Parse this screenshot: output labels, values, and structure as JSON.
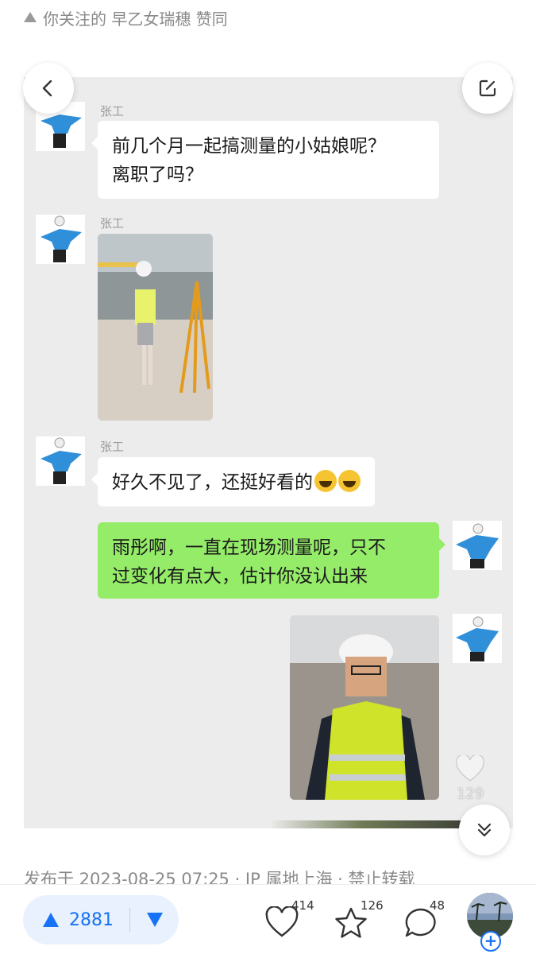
{
  "follow_bar": {
    "text": "你关注的 早乙女瑞穗 赞同"
  },
  "chat": {
    "messages": [
      {
        "sender": "张工",
        "text_line1": "前几个月一起搞测量的小姑娘呢？",
        "text_line2": "离职了吗？"
      },
      {
        "sender": "张工"
      },
      {
        "sender": "张工",
        "text": "好久不见了，还挺好看的"
      },
      {
        "text_line1": "雨彤啊，一直在现场测量呢，只不",
        "text_line2": "过变化有点大，估计你没认出来"
      }
    ]
  },
  "image_like": {
    "count": "129"
  },
  "publish_meta": "发布于 2023-08-25 07:25 · IP 属地上海 · 禁止转载",
  "bottom_bar": {
    "upvote_count": "2881",
    "likes": "414",
    "favorites": "126",
    "comments": "48"
  },
  "colors": {
    "accent": "#1772f6",
    "green_bubble": "#95ec69",
    "chat_bg": "#ececec"
  },
  "icons": [
    "triangle-up-icon",
    "back-arrow-icon",
    "edit-icon",
    "heart-icon",
    "double-chevron-down-icon",
    "upvote-triangle-icon",
    "downvote-triangle-icon",
    "star-icon",
    "comment-icon",
    "plus-icon"
  ]
}
